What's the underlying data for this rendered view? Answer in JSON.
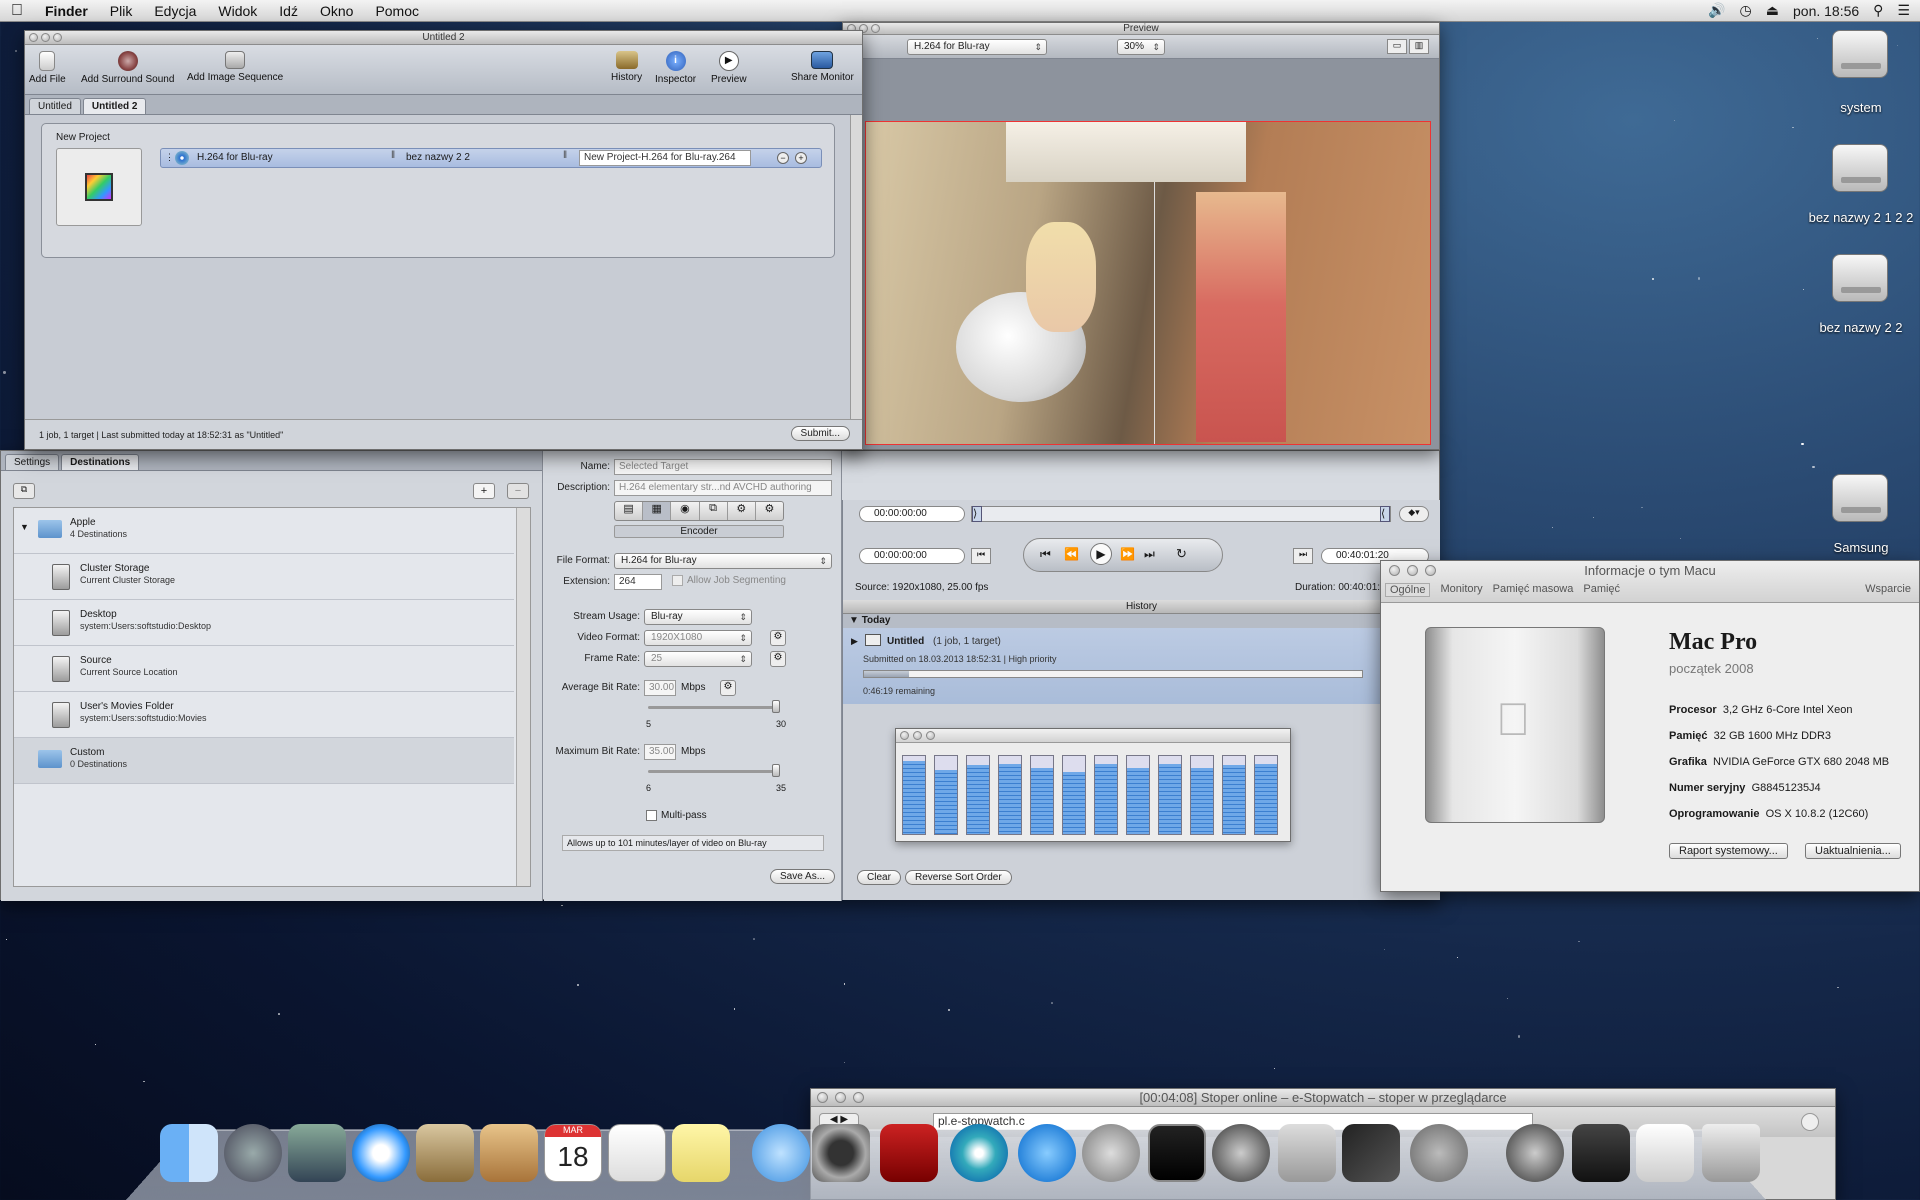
{
  "menubar": {
    "apple": "",
    "app": "Finder",
    "items": [
      "Plik",
      "Edycja",
      "Widok",
      "Idź",
      "Okno",
      "Pomoc"
    ],
    "clock": "pon. 18:56"
  },
  "desktop_icons": [
    {
      "label": "system"
    },
    {
      "label": "bez nazwy 2 1 2 2"
    },
    {
      "label": "bez nazwy 2 2"
    },
    {
      "label": "Samsung"
    }
  ],
  "batch": {
    "title": "Untitled 2",
    "toolbar": {
      "add_file": "Add File",
      "add_surround": "Add Surround Sound",
      "add_image_seq": "Add Image Sequence",
      "history": "History",
      "inspector": "Inspector",
      "preview": "Preview",
      "share_monitor": "Share Monitor"
    },
    "tabs": [
      "Untitled",
      "Untitled 2"
    ],
    "project_label": "New Project",
    "job": {
      "setting": "H.264 for Blu-ray",
      "destination": "bez nazwy 2 2",
      "output": "New Project-H.264 for Blu-ray.264"
    },
    "status": "1 job, 1 target   |   Last submitted today at 18:52:31 as \"Untitled\"",
    "submit": "Submit..."
  },
  "dest": {
    "tabs": [
      "Settings",
      "Destinations"
    ],
    "rows": [
      {
        "title": "Apple",
        "sub": "4 Destinations",
        "kind": "folder"
      },
      {
        "title": "Cluster Storage",
        "sub": "Current Cluster Storage",
        "kind": "disk"
      },
      {
        "title": "Desktop",
        "sub": "system:Users:softstudio:Desktop",
        "kind": "disk"
      },
      {
        "title": "Source",
        "sub": "Current Source Location",
        "kind": "disk"
      },
      {
        "title": "User's Movies Folder",
        "sub": "system:Users:softstudio:Movies",
        "kind": "disk"
      },
      {
        "title": "Custom",
        "sub": "0 Destinations",
        "kind": "folder"
      }
    ]
  },
  "inspector": {
    "name_label": "Name:",
    "name_value": "Selected Target",
    "desc_label": "Description:",
    "desc_value": "H.264 elementary str...nd AVCHD authoring",
    "encoder": "Encoder",
    "file_format_label": "File Format:",
    "file_format": "H.264 for Blu-ray",
    "ext_label": "Extension:",
    "ext": "264",
    "allow_seg": "Allow Job Segmenting",
    "stream_usage_label": "Stream Usage:",
    "stream_usage": "Blu-ray",
    "video_format_label": "Video Format:",
    "video_format": "1920X1080",
    "frame_rate_label": "Frame Rate:",
    "frame_rate": "25",
    "avg_label": "Average Bit Rate:",
    "avg_value": "30.00",
    "mbps": "Mbps",
    "avg_min": "5",
    "avg_max": "30",
    "max_label": "Maximum Bit Rate:",
    "max_value": "35.00",
    "max_min": "6",
    "max_max": "35",
    "multipass": "Multi-pass",
    "note": "Allows up to 101 minutes/layer of video on Blu-ray",
    "save": "Save As..."
  },
  "preview": {
    "title": "Preview",
    "setting": "H.264 for Blu-ray",
    "zoom": "30%",
    "tc_in": "00:00:00:00",
    "tc_cur": "00:00:00:00",
    "tc_end": "00:40:01:20",
    "source": "Source: 1920x1080, 25.00 fps",
    "duration": "Duration: 00:40:01:"
  },
  "history": {
    "title": "History",
    "group": "Today",
    "job_name": "Untitled",
    "job_info": "(1 job, 1 target)",
    "submitted": "Submitted on 18.03.2013 18:52:31  |  High priority",
    "remaining": "0:46:19 remaining",
    "progress": 0.09,
    "clear": "Clear",
    "reverse": "Reverse Sort Order"
  },
  "cpu_meter": {
    "bars": [
      0.93,
      0.82,
      0.88,
      0.9,
      0.85,
      0.8,
      0.9,
      0.85,
      0.9,
      0.85,
      0.88,
      0.9
    ]
  },
  "about": {
    "title": "Informacje o tym Macu",
    "tabs": [
      "Ogólne",
      "Monitory",
      "Pamięć masowa",
      "Pamięć"
    ],
    "support": "Wsparcie",
    "model": "Mac Pro",
    "year": "początek 2008",
    "specs": [
      {
        "k": "Procesor",
        "v": "3,2 GHz 6-Core Intel Xeon"
      },
      {
        "k": "Pamięć",
        "v": "32 GB 1600 MHz DDR3"
      },
      {
        "k": "Grafika",
        "v": "NVIDIA GeForce GTX 680 2048  MB"
      },
      {
        "k": "Numer seryjny",
        "v": "G88451235J4"
      },
      {
        "k": "Oprogramowanie",
        "v": "OS X 10.8.2 (12C60)"
      }
    ],
    "btn_report": "Raport systemowy...",
    "btn_update": "Uaktualnienia..."
  },
  "browser": {
    "title": "[00:04:08] Stoper online – e-Stopwatch – stoper w przeglądarce",
    "url": "pl.e-stopwatch.c"
  },
  "dock": {
    "calendar_day": "18",
    "calendar_month": "MAR"
  }
}
